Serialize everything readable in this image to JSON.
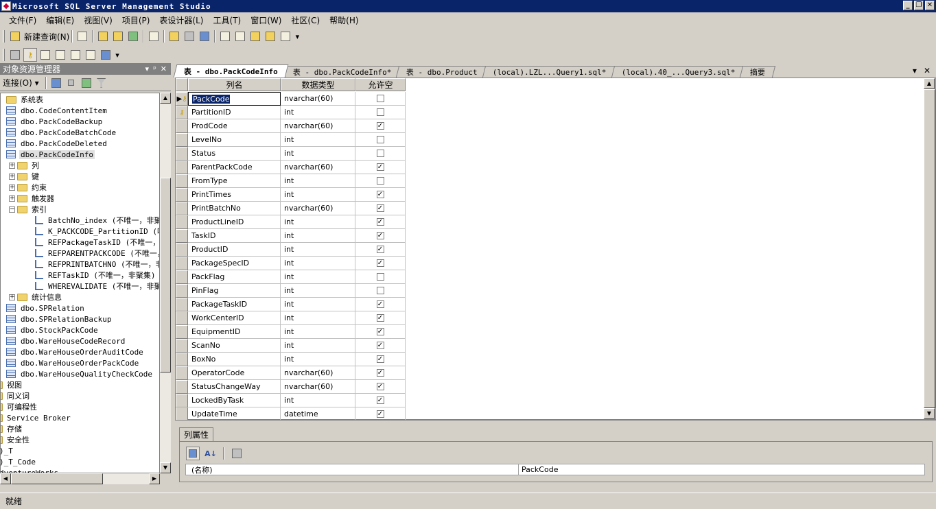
{
  "window": {
    "title": "Microsoft SQL Server Management Studio"
  },
  "menu": [
    "文件(F)",
    "编辑(E)",
    "视图(V)",
    "项目(P)",
    "表设计器(L)",
    "工具(T)",
    "窗口(W)",
    "社区(C)",
    "帮助(H)"
  ],
  "toolbar": {
    "new_query_label": "新建查询(N)"
  },
  "object_explorer": {
    "title": "对象资源管理器",
    "controls": [
      "▾",
      "ᵖ",
      "✕"
    ],
    "connect_label": "连接(O) ▾",
    "tree": [
      {
        "label": "系统表",
        "kind": "folder",
        "depth": 0
      },
      {
        "label": "dbo.CodeContentItem",
        "kind": "table",
        "depth": 0
      },
      {
        "label": "dbo.PackCodeBackup",
        "kind": "table",
        "depth": 0
      },
      {
        "label": "dbo.PackCodeBatchCode",
        "kind": "table",
        "depth": 0
      },
      {
        "label": "dbo.PackCodeDeleted",
        "kind": "table",
        "depth": 0
      },
      {
        "label": "dbo.PackCodeInfo",
        "kind": "table",
        "depth": 0,
        "selected": true
      },
      {
        "label": "列",
        "kind": "folder",
        "depth": 1,
        "expander": "+"
      },
      {
        "label": "键",
        "kind": "folder",
        "depth": 1,
        "expander": "+"
      },
      {
        "label": "约束",
        "kind": "folder",
        "depth": 1,
        "expander": "+"
      },
      {
        "label": "触发器",
        "kind": "folder",
        "depth": 1,
        "expander": "+"
      },
      {
        "label": "索引",
        "kind": "folder",
        "depth": 1,
        "expander": "−"
      },
      {
        "label": "BatchNo_index (不唯一，非聚",
        "kind": "index",
        "depth": 2
      },
      {
        "label": "K_PACKCODE_PartitionID (唯一",
        "kind": "index",
        "depth": 2
      },
      {
        "label": "REFPackageTaskID (不唯一，非",
        "kind": "index",
        "depth": 2
      },
      {
        "label": "REFPARENTPACKCODE (不唯一，",
        "kind": "index",
        "depth": 2
      },
      {
        "label": "REFPRINTBATCHNO (不唯一，非",
        "kind": "index",
        "depth": 2
      },
      {
        "label": "REFTaskID (不唯一，非聚集)",
        "kind": "index",
        "depth": 2
      },
      {
        "label": "WHEREVALIDATE (不唯一，非聚",
        "kind": "index",
        "depth": 2
      },
      {
        "label": "统计信息",
        "kind": "folder",
        "depth": 1,
        "expander": "+"
      },
      {
        "label": "dbo.SPRelation",
        "kind": "table",
        "depth": 0
      },
      {
        "label": "dbo.SPRelationBackup",
        "kind": "table",
        "depth": 0
      },
      {
        "label": "dbo.StockPackCode",
        "kind": "table",
        "depth": 0
      },
      {
        "label": "dbo.WareHouseCodeRecord",
        "kind": "table",
        "depth": 0
      },
      {
        "label": "dbo.WareHouseOrderAuditCode",
        "kind": "table",
        "depth": 0
      },
      {
        "label": "dbo.WareHouseOrderPackCode",
        "kind": "table",
        "depth": 0
      },
      {
        "label": "dbo.WareHouseQualityCheckCode",
        "kind": "table",
        "depth": 0
      },
      {
        "label": "视图",
        "kind": "folder-cut",
        "depth": -1
      },
      {
        "label": "同义词",
        "kind": "folder-cut",
        "depth": -1
      },
      {
        "label": "可编程性",
        "kind": "folder-cut",
        "depth": -1
      },
      {
        "label": "Service Broker",
        "kind": "folder-cut",
        "depth": -1
      },
      {
        "label": "存储",
        "kind": "folder-cut",
        "depth": -1
      },
      {
        "label": "安全性",
        "kind": "folder-cut",
        "depth": -1
      },
      {
        "label": ")_T",
        "kind": "text",
        "depth": -2
      },
      {
        "label": ")_T_Code",
        "kind": "text",
        "depth": -2
      },
      {
        "label": "dventureWorks",
        "kind": "text",
        "depth": -2
      }
    ]
  },
  "tabs": [
    {
      "label": "表 - dbo.PackCodeInfo",
      "active": true
    },
    {
      "label": "表 - dbo.PackCodeInfo*",
      "active": false
    },
    {
      "label": "表 - dbo.Product",
      "active": false
    },
    {
      "label": "(local).LZL...Query1.sql*",
      "active": false
    },
    {
      "label": "(local).40_...Query3.sql*",
      "active": false
    },
    {
      "label": "摘要",
      "active": false
    }
  ],
  "tab_controls": [
    "▾",
    "✕"
  ],
  "grid": {
    "headers": {
      "name": "列名",
      "type": "数据类型",
      "null": "允许空"
    },
    "rows": [
      {
        "name": "PackCode",
        "type": "nvarchar(60)",
        "nullable": false,
        "marker": "current-key"
      },
      {
        "name": "PartitionID",
        "type": "int",
        "nullable": false,
        "marker": "key"
      },
      {
        "name": "ProdCode",
        "type": "nvarchar(60)",
        "nullable": true
      },
      {
        "name": "LevelNo",
        "type": "int",
        "nullable": false
      },
      {
        "name": "Status",
        "type": "int",
        "nullable": false
      },
      {
        "name": "ParentPackCode",
        "type": "nvarchar(60)",
        "nullable": true
      },
      {
        "name": "FromType",
        "type": "int",
        "nullable": false
      },
      {
        "name": "PrintTimes",
        "type": "int",
        "nullable": true
      },
      {
        "name": "PrintBatchNo",
        "type": "nvarchar(60)",
        "nullable": true
      },
      {
        "name": "ProductLineID",
        "type": "int",
        "nullable": true
      },
      {
        "name": "TaskID",
        "type": "int",
        "nullable": true
      },
      {
        "name": "ProductID",
        "type": "int",
        "nullable": true
      },
      {
        "name": "PackageSpecID",
        "type": "int",
        "nullable": true
      },
      {
        "name": "PackFlag",
        "type": "int",
        "nullable": false
      },
      {
        "name": "PinFlag",
        "type": "int",
        "nullable": false
      },
      {
        "name": "PackageTaskID",
        "type": "int",
        "nullable": true
      },
      {
        "name": "WorkCenterID",
        "type": "int",
        "nullable": true
      },
      {
        "name": "EquipmentID",
        "type": "int",
        "nullable": true
      },
      {
        "name": "ScanNo",
        "type": "int",
        "nullable": true
      },
      {
        "name": "BoxNo",
        "type": "int",
        "nullable": true
      },
      {
        "name": "OperatorCode",
        "type": "nvarchar(60)",
        "nullable": true
      },
      {
        "name": "StatusChangeWay",
        "type": "nvarchar(60)",
        "nullable": true
      },
      {
        "name": "LockedByTask",
        "type": "int",
        "nullable": true
      },
      {
        "name": "UpdateTime",
        "type": "datetime",
        "nullable": true
      }
    ]
  },
  "column_properties": {
    "tab_label": "列属性",
    "property_name": "(名称)",
    "property_value": "PackCode"
  },
  "status": {
    "text": "就绪"
  }
}
